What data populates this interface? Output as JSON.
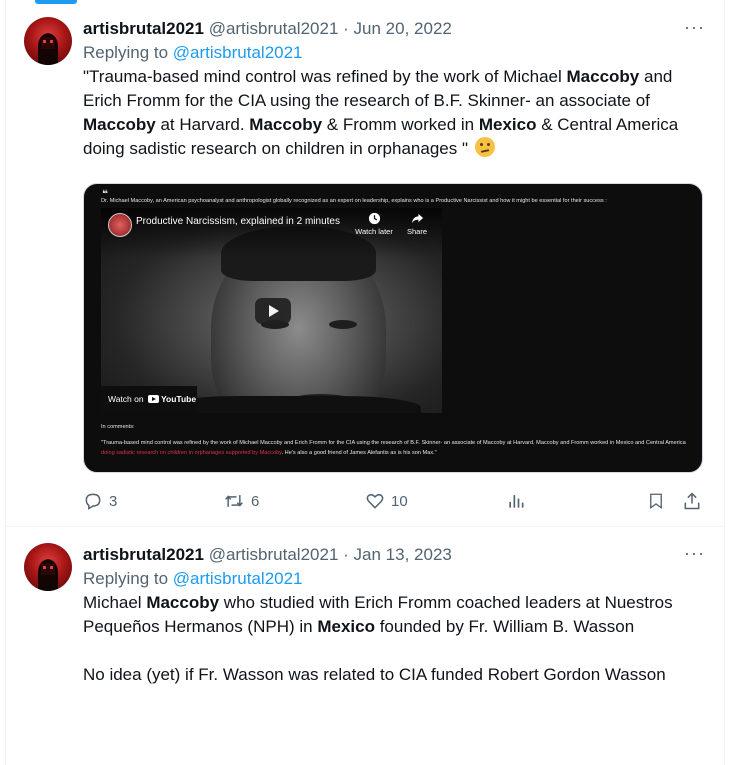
{
  "tweets": [
    {
      "name": "artisbrutal2021",
      "handle": "@artisbrutal2021",
      "date": "Jun 20, 2022",
      "more": "···",
      "reply_prefix": "Replying to",
      "reply_to": "@artisbrutal2021",
      "text_segments": [
        {
          "t": "\"Trauma-based mind control was refined by the work of Michael ",
          "b": false
        },
        {
          "t": "Maccoby",
          "b": true
        },
        {
          "t": " and Erich Fromm for the CIA using the research of B.F. Skinner- an associate of ",
          "b": false
        },
        {
          "t": "Maccoby",
          "b": true
        },
        {
          "t": " at Harvard. ",
          "b": false
        },
        {
          "t": "Maccoby",
          "b": true
        },
        {
          "t": " & Fromm worked in ",
          "b": false
        },
        {
          "t": "Mexico",
          "b": true
        },
        {
          "t": " & Central America doing sadistic research on children in orphanages \" ",
          "b": false
        }
      ],
      "emoji": "thinking-face",
      "media": {
        "quote_mark": "❝",
        "intro": "Dr. Michael Maccoby, an American psychoanalyst and anthropologist globally recognized as an expert on leadership, explains who is a Productive Narcissist and how it might be essential for their success :",
        "video_title": "Productive Narcissism, explained in 2 minutes",
        "watch_later": "Watch later",
        "share": "Share",
        "watch_on": "Watch on",
        "youtube": "YouTube",
        "in_comments": "In comments:",
        "comment_before": "\"Trauma-based mind control was refined by the work of Michael Maccoby and Erich Fromm for the CIA using the research of B.F. Skinner- an associate of Maccoby at Harvard. Maccoby and Fromm worked in Mexico and Central America ",
        "comment_red": "doing sadistic research on children in orphanages supported by Maccoby",
        "comment_after": ". He's also a good friend of James Alefantis as is his son Max.\""
      },
      "stats": {
        "replies": "3",
        "retweets": "6",
        "likes": "10"
      }
    },
    {
      "name": "artisbrutal2021",
      "handle": "@artisbrutal2021",
      "date": "Jan 13, 2023",
      "more": "···",
      "reply_prefix": "Replying to",
      "reply_to": "@artisbrutal2021",
      "para1_segments": [
        {
          "t": "Michael ",
          "b": false
        },
        {
          "t": "Maccoby",
          "b": true
        },
        {
          "t": " who studied with Erich Fromm coached leaders at Nuestros Pequeños Hermanos (NPH) in ",
          "b": false
        },
        {
          "t": "Mexico",
          "b": true
        },
        {
          "t": " founded by Fr. William B. Wasson",
          "b": false
        }
      ],
      "para2": "No idea (yet) if Fr. Wasson was related to CIA funded Robert Gordon Wasson"
    }
  ],
  "colors": {
    "accent": "#1d9bf0",
    "muted": "#536471",
    "text": "#0f1419",
    "highlight_red": "#e0304a"
  }
}
